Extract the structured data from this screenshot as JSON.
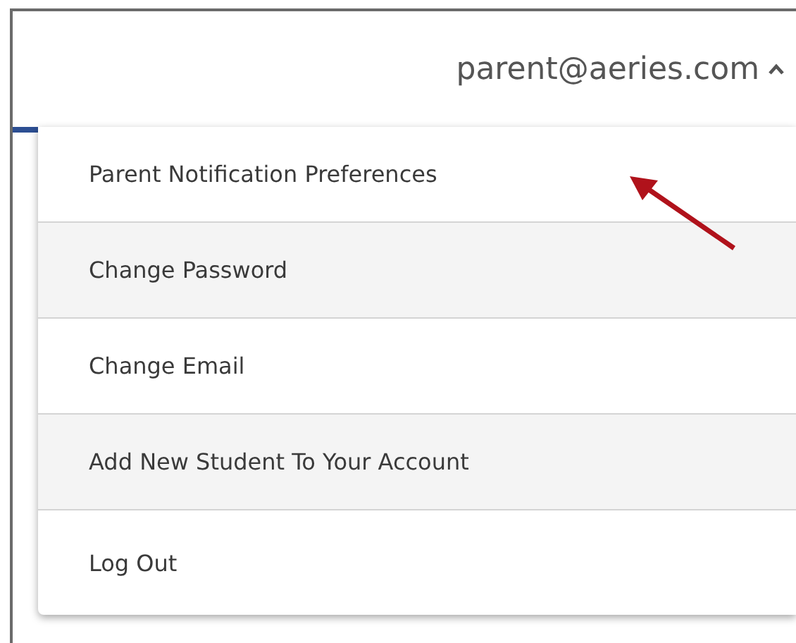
{
  "account_menu": {
    "email": "parent@aeries.com",
    "expanded": true
  },
  "menu_items": [
    {
      "label": "Parent Notification Preferences",
      "highlighted": true
    },
    {
      "label": "Change Password",
      "highlighted": false
    },
    {
      "label": "Change Email",
      "highlighted": false
    },
    {
      "label": "Add New Student To Your Account",
      "highlighted": false
    },
    {
      "label": "Log Out",
      "highlighted": false
    }
  ]
}
